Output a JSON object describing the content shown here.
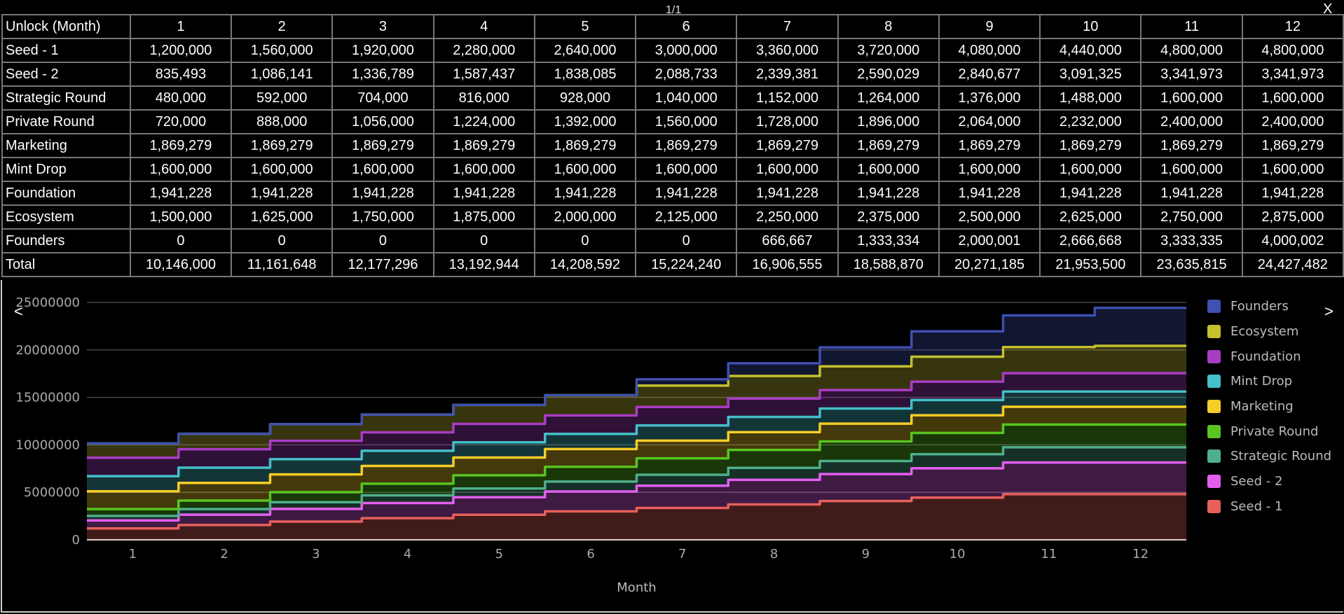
{
  "pager": "1/1",
  "close": "X",
  "nav": {
    "prev": "<",
    "next": ">"
  },
  "table": {
    "header": [
      "Unlock (Month)",
      "1",
      "2",
      "3",
      "4",
      "5",
      "6",
      "7",
      "8",
      "9",
      "10",
      "11",
      "12"
    ],
    "rows": [
      [
        "Seed - 1",
        "1,200,000",
        "1,560,000",
        "1,920,000",
        "2,280,000",
        "2,640,000",
        "3,000,000",
        "3,360,000",
        "3,720,000",
        "4,080,000",
        "4,440,000",
        "4,800,000",
        "4,800,000"
      ],
      [
        "Seed - 2",
        "835,493",
        "1,086,141",
        "1,336,789",
        "1,587,437",
        "1,838,085",
        "2,088,733",
        "2,339,381",
        "2,590,029",
        "2,840,677",
        "3,091,325",
        "3,341,973",
        "3,341,973"
      ],
      [
        "Strategic Round",
        "480,000",
        "592,000",
        "704,000",
        "816,000",
        "928,000",
        "1,040,000",
        "1,152,000",
        "1,264,000",
        "1,376,000",
        "1,488,000",
        "1,600,000",
        "1,600,000"
      ],
      [
        "Private Round",
        "720,000",
        "888,000",
        "1,056,000",
        "1,224,000",
        "1,392,000",
        "1,560,000",
        "1,728,000",
        "1,896,000",
        "2,064,000",
        "2,232,000",
        "2,400,000",
        "2,400,000"
      ],
      [
        "Marketing",
        "1,869,279",
        "1,869,279",
        "1,869,279",
        "1,869,279",
        "1,869,279",
        "1,869,279",
        "1,869,279",
        "1,869,279",
        "1,869,279",
        "1,869,279",
        "1,869,279",
        "1,869,279"
      ],
      [
        "Mint Drop",
        "1,600,000",
        "1,600,000",
        "1,600,000",
        "1,600,000",
        "1,600,000",
        "1,600,000",
        "1,600,000",
        "1,600,000",
        "1,600,000",
        "1,600,000",
        "1,600,000",
        "1,600,000"
      ],
      [
        "Foundation",
        "1,941,228",
        "1,941,228",
        "1,941,228",
        "1,941,228",
        "1,941,228",
        "1,941,228",
        "1,941,228",
        "1,941,228",
        "1,941,228",
        "1,941,228",
        "1,941,228",
        "1,941,228"
      ],
      [
        "Ecosystem",
        "1,500,000",
        "1,625,000",
        "1,750,000",
        "1,875,000",
        "2,000,000",
        "2,125,000",
        "2,250,000",
        "2,375,000",
        "2,500,000",
        "2,625,000",
        "2,750,000",
        "2,875,000"
      ],
      [
        "Founders",
        "0",
        "0",
        "0",
        "0",
        "0",
        "0",
        "666,667",
        "1,333,334",
        "2,000,001",
        "2,666,668",
        "3,333,335",
        "4,000,002"
      ],
      [
        "Total",
        "10,146,000",
        "11,161,648",
        "12,177,296",
        "13,192,944",
        "14,208,592",
        "15,224,240",
        "16,906,555",
        "18,588,870",
        "20,271,185",
        "21,953,500",
        "23,635,815",
        "24,427,482"
      ]
    ]
  },
  "chart_data": {
    "type": "area",
    "stacked": true,
    "step": true,
    "xlabel": "Month",
    "ylabel": "",
    "categories": [
      "1",
      "2",
      "3",
      "4",
      "5",
      "6",
      "7",
      "8",
      "9",
      "10",
      "11",
      "12"
    ],
    "ylim": [
      0,
      25000000
    ],
    "yticks": [
      "0",
      "5000000",
      "10000000",
      "15000000",
      "20000000",
      "25000000"
    ],
    "grid": true,
    "legend": "right",
    "series": [
      {
        "name": "Seed - 1",
        "color": "#e8605c",
        "values": [
          1200000,
          1560000,
          1920000,
          2280000,
          2640000,
          3000000,
          3360000,
          3720000,
          4080000,
          4440000,
          4800000,
          4800000
        ]
      },
      {
        "name": "Seed - 2",
        "color": "#e35ff0",
        "values": [
          835493,
          1086141,
          1336789,
          1587437,
          1838085,
          2088733,
          2339381,
          2590029,
          2840677,
          3091325,
          3341973,
          3341973
        ]
      },
      {
        "name": "Strategic Round",
        "color": "#4fae8c",
        "values": [
          480000,
          592000,
          704000,
          816000,
          928000,
          1040000,
          1152000,
          1264000,
          1376000,
          1488000,
          1600000,
          1600000
        ]
      },
      {
        "name": "Private Round",
        "color": "#5ac420",
        "values": [
          720000,
          888000,
          1056000,
          1224000,
          1392000,
          1560000,
          1728000,
          1896000,
          2064000,
          2232000,
          2400000,
          2400000
        ]
      },
      {
        "name": "Marketing",
        "color": "#f5cd28",
        "values": [
          1869279,
          1869279,
          1869279,
          1869279,
          1869279,
          1869279,
          1869279,
          1869279,
          1869279,
          1869279,
          1869279,
          1869279
        ]
      },
      {
        "name": "Mint Drop",
        "color": "#45bfc8",
        "values": [
          1600000,
          1600000,
          1600000,
          1600000,
          1600000,
          1600000,
          1600000,
          1600000,
          1600000,
          1600000,
          1600000,
          1600000
        ]
      },
      {
        "name": "Foundation",
        "color": "#a83dc4",
        "values": [
          1941228,
          1941228,
          1941228,
          1941228,
          1941228,
          1941228,
          1941228,
          1941228,
          1941228,
          1941228,
          1941228,
          1941228
        ]
      },
      {
        "name": "Ecosystem",
        "color": "#c4c030",
        "values": [
          1500000,
          1625000,
          1750000,
          1875000,
          2000000,
          2125000,
          2250000,
          2375000,
          2500000,
          2625000,
          2750000,
          2875000
        ]
      },
      {
        "name": "Founders",
        "color": "#3e50b0",
        "values": [
          0,
          0,
          0,
          0,
          0,
          0,
          666667,
          1333334,
          2000001,
          2666668,
          3333335,
          4000002
        ]
      }
    ]
  }
}
